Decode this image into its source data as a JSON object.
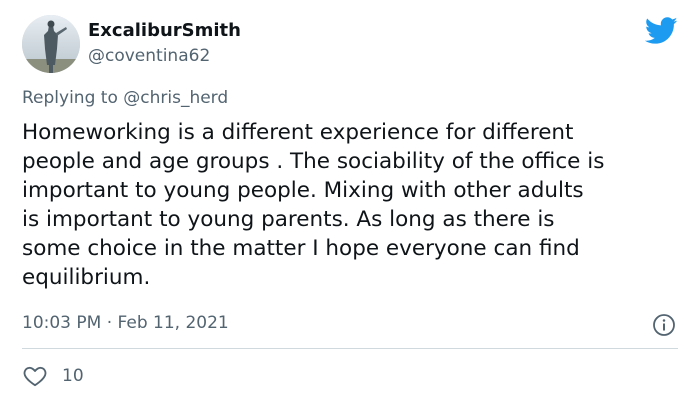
{
  "tweet": {
    "author": {
      "display_name": "ExcaliburSmith",
      "handle": "@coventina62"
    },
    "reply": {
      "prefix": "Replying to",
      "mention": "@chris_herd"
    },
    "text": "Homeworking is a different experience for different\npeople and age groups . The sociability of the office is\nimportant to young people. Mixing with other adults\nis important to young parents. As long as there is\nsome choice in the matter I hope everyone can find\nequilibrium.",
    "timestamp": "10:03 PM · Feb 11, 2021",
    "likes": "10"
  },
  "icons": {
    "brand": "twitter-bird-icon",
    "info": "info-icon",
    "like": "heart-icon"
  },
  "colors": {
    "brand_blue": "#1d9bf0",
    "secondary_text": "#536471",
    "primary_text": "#0f1419",
    "divider": "#cfd9de"
  }
}
